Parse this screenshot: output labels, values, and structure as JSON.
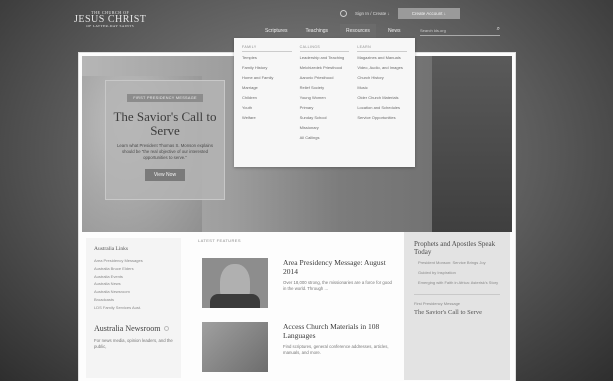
{
  "header": {
    "logo": {
      "line1": "THE CHURCH OF",
      "line2": "JESUS CHRIST",
      "line3": "OF LATTER-DAY SAINTS"
    },
    "sign_in": "Sign In / Create ↓",
    "account_button": "Create Account  ↓",
    "nav": [
      "Scriptures",
      "Teachings",
      "Resources",
      "News"
    ],
    "search_placeholder": "Search lds.org"
  },
  "resources_menu": {
    "columns": [
      {
        "heading": "FAMILY",
        "items": [
          "Temples",
          "Family History",
          "Home and Family",
          "Marriage",
          "Children",
          "Youth",
          "Welfare"
        ]
      },
      {
        "heading": "CALLINGS",
        "items": [
          "Leadership and Teaching",
          "Melchizedek Priesthood",
          "Aaronic Priesthood",
          "Relief Society",
          "Young Women",
          "Primary",
          "Sunday School",
          "Missionary",
          "All Callings"
        ]
      },
      {
        "heading": "LEARN",
        "items": [
          "Magazines and Manuals",
          "Video, Audio, and Images",
          "Church History",
          "Music",
          "Older Church Materials",
          "Location and Schedules",
          "Service Opportunities"
        ]
      }
    ]
  },
  "hero": {
    "tag": "FIRST PRESIDENCY MESSAGE",
    "title": "The Savior's Call to Serve",
    "text": "Learn what President Thomas S. Monson explains should be \"the real objective of our interested opportunities to serve.\"",
    "button": "View Now"
  },
  "left": {
    "heading": "Australia Links",
    "links": [
      "Area Presidency Messages",
      "Australia Bruce Elders",
      "Australia Events",
      "Australia News",
      "Australia Newsroom",
      "Broadcasts",
      "LDS Family Services Aust."
    ],
    "newsroom": "Australia Newsroom",
    "newsroom_text": "For news media, opinion leaders, and the public,"
  },
  "features": {
    "label": "LATEST FEATURES",
    "items": [
      {
        "title": "Area Presidency Message: August 2014",
        "text": "Over 18,000 strong, the missionaries are a force for good in the world. Through ..."
      },
      {
        "title": "Access Church Materials in 108 Languages",
        "text": "Find scriptures, general conference addresses, articles, manuals, and more."
      }
    ]
  },
  "right": {
    "heading": "Prophets and Apostles Speak Today",
    "links": [
      "President Monson: Service Brings Joy",
      "Guided by Inspiration",
      "Emerging with Faith in Africa: Asterisk's Story"
    ],
    "small": "First Presidency Message",
    "title": "The Savior's Call to Serve"
  }
}
